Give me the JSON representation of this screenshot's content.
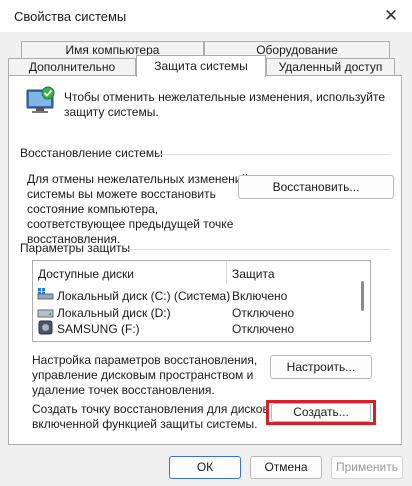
{
  "window": {
    "title": "Свойства системы",
    "close_glyph": "✕"
  },
  "tabs": {
    "row1": [
      "Имя компьютера",
      "Оборудование"
    ],
    "row2": [
      "Дополнительно",
      "Защита системы",
      "Удаленный доступ"
    ],
    "active": "Защита системы"
  },
  "intro": {
    "text_line1": "Чтобы отменить нежелательные изменения, используйте",
    "text_line2": "защиту системы.",
    "icon": "system-protection-icon"
  },
  "restore": {
    "heading": "Восстановление системы",
    "text": [
      "Для отмены нежелательных изменений",
      "системы вы можете восстановить",
      "состояние компьютера,",
      "соответствующее предыдущей точке",
      "восстановления."
    ],
    "button": "Восстановить..."
  },
  "protection": {
    "heading": "Параметры защиты",
    "columns": [
      "Доступные диски",
      "Защита"
    ],
    "drives": [
      {
        "name": "Локальный диск (C:) (Система)",
        "status": "Включено",
        "icon": "system-drive-icon"
      },
      {
        "name": "Локальный диск (D:)",
        "status": "Отключено",
        "icon": "drive-icon"
      },
      {
        "name": "SAMSUNG (F:)",
        "status": "Отключено",
        "icon": "removable-drive-icon"
      }
    ]
  },
  "configure": {
    "text": [
      "Настройка параметров восстановления,",
      "управление дисковым пространством и",
      "удаление точек восстановления."
    ],
    "button": "Настроить..."
  },
  "create": {
    "text": [
      "Создать точку восстановления для дисков с",
      "включенной функцией защиты системы."
    ],
    "button": "Создать...",
    "highlight_color": "#d9202a"
  },
  "footer": {
    "ok": "ОК",
    "cancel": "Отмена",
    "apply": "Применить"
  }
}
